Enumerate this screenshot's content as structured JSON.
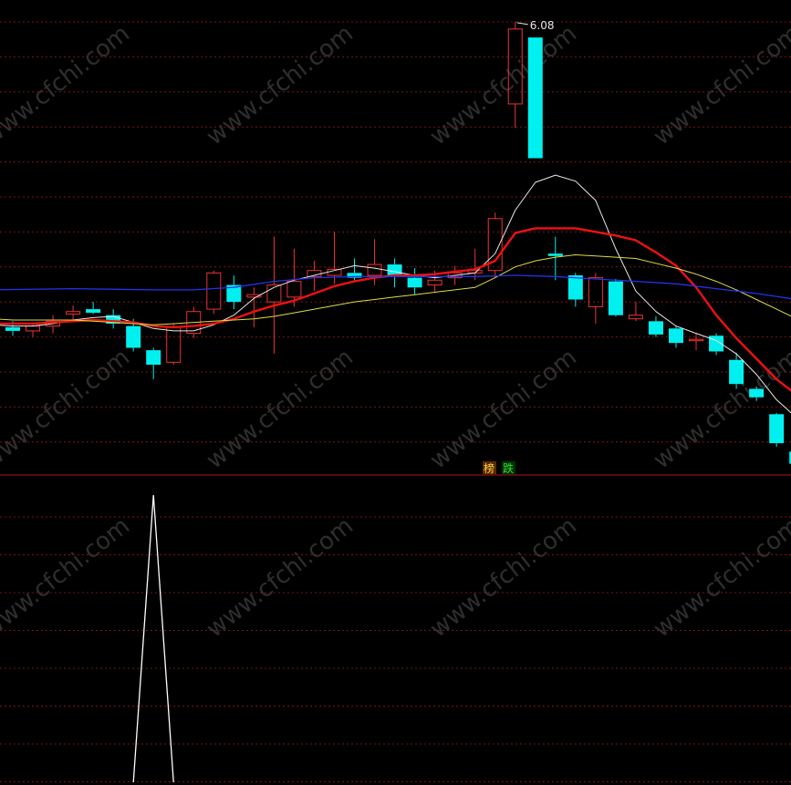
{
  "chart_data": {
    "type": "candlestick",
    "price_panel": {
      "ylim": [
        2.5,
        6.2
      ],
      "peak_label": "6.08",
      "peak_value": 6.08,
      "bottom_marker": "←",
      "signal_labels": [
        {
          "text": "榜",
          "color": "#ffd24a",
          "bg": "#5a2a00"
        },
        {
          "text": "跌",
          "color": "#33dd33",
          "bg": "#003300"
        }
      ],
      "candles": [
        {
          "i": 0,
          "o": 3.55,
          "h": 3.6,
          "l": 3.48,
          "c": 3.52
        },
        {
          "i": 1,
          "o": 3.52,
          "h": 3.58,
          "l": 3.47,
          "c": 3.56
        },
        {
          "i": 2,
          "o": 3.56,
          "h": 3.65,
          "l": 3.5,
          "c": 3.6
        },
        {
          "i": 3,
          "o": 3.66,
          "h": 3.73,
          "l": 3.61,
          "c": 3.68
        },
        {
          "i": 4,
          "o": 3.7,
          "h": 3.76,
          "l": 3.66,
          "c": 3.67
        },
        {
          "i": 5,
          "o": 3.65,
          "h": 3.7,
          "l": 3.54,
          "c": 3.58
        },
        {
          "i": 6,
          "o": 3.56,
          "h": 3.62,
          "l": 3.35,
          "c": 3.38
        },
        {
          "i": 7,
          "o": 3.36,
          "h": 3.38,
          "l": 3.12,
          "c": 3.24
        },
        {
          "i": 8,
          "o": 3.26,
          "h": 3.58,
          "l": 3.24,
          "c": 3.55
        },
        {
          "i": 9,
          "o": 3.5,
          "h": 3.72,
          "l": 3.46,
          "c": 3.68
        },
        {
          "i": 10,
          "o": 3.7,
          "h": 4.02,
          "l": 3.66,
          "c": 4.0
        },
        {
          "i": 11,
          "o": 3.9,
          "h": 3.98,
          "l": 3.7,
          "c": 3.76
        },
        {
          "i": 12,
          "o": 3.8,
          "h": 3.88,
          "l": 3.55,
          "c": 3.82
        },
        {
          "i": 13,
          "o": 3.76,
          "h": 4.3,
          "l": 3.33,
          "c": 3.9
        },
        {
          "i": 14,
          "o": 3.8,
          "h": 4.2,
          "l": 3.72,
          "c": 3.93
        },
        {
          "i": 15,
          "o": 3.97,
          "h": 4.1,
          "l": 3.85,
          "c": 4.02
        },
        {
          "i": 16,
          "o": 3.98,
          "h": 4.34,
          "l": 3.91,
          "c": 4.03
        },
        {
          "i": 17,
          "o": 4.0,
          "h": 4.12,
          "l": 3.94,
          "c": 3.96
        },
        {
          "i": 18,
          "o": 3.98,
          "h": 4.28,
          "l": 3.9,
          "c": 4.07
        },
        {
          "i": 19,
          "o": 4.07,
          "h": 4.12,
          "l": 3.88,
          "c": 3.98
        },
        {
          "i": 20,
          "o": 3.96,
          "h": 4.04,
          "l": 3.82,
          "c": 3.88
        },
        {
          "i": 21,
          "o": 3.9,
          "h": 4.02,
          "l": 3.84,
          "c": 3.94
        },
        {
          "i": 22,
          "o": 3.96,
          "h": 4.06,
          "l": 3.9,
          "c": 4.0
        },
        {
          "i": 23,
          "o": 4.0,
          "h": 4.2,
          "l": 3.94,
          "c": 4.02
        },
        {
          "i": 24,
          "o": 4.02,
          "h": 4.5,
          "l": 3.96,
          "c": 4.45
        },
        {
          "i": 25,
          "o": 5.4,
          "h": 6.08,
          "l": 5.2,
          "c": 6.02
        },
        {
          "i": 26,
          "o": 5.95,
          "h": 5.95,
          "l": 4.95,
          "c": 4.95
        },
        {
          "i": 27,
          "o": 4.16,
          "h": 4.3,
          "l": 3.94,
          "c": 4.14
        },
        {
          "i": 28,
          "o": 3.98,
          "h": 4.0,
          "l": 3.72,
          "c": 3.78
        },
        {
          "i": 29,
          "o": 3.72,
          "h": 4.0,
          "l": 3.58,
          "c": 3.96
        },
        {
          "i": 30,
          "o": 3.93,
          "h": 3.95,
          "l": 3.64,
          "c": 3.65
        },
        {
          "i": 31,
          "o": 3.62,
          "h": 3.76,
          "l": 3.6,
          "c": 3.65
        },
        {
          "i": 32,
          "o": 3.6,
          "h": 3.64,
          "l": 3.47,
          "c": 3.49
        },
        {
          "i": 33,
          "o": 3.54,
          "h": 3.56,
          "l": 3.38,
          "c": 3.42
        },
        {
          "i": 34,
          "o": 3.45,
          "h": 3.5,
          "l": 3.36,
          "c": 3.45
        },
        {
          "i": 35,
          "o": 3.48,
          "h": 3.5,
          "l": 3.32,
          "c": 3.35
        },
        {
          "i": 36,
          "o": 3.28,
          "h": 3.34,
          "l": 3.04,
          "c": 3.08
        },
        {
          "i": 37,
          "o": 3.04,
          "h": 3.06,
          "l": 2.94,
          "c": 2.97
        },
        {
          "i": 38,
          "o": 2.83,
          "h": 2.84,
          "l": 2.56,
          "c": 2.59
        },
        {
          "i": 39,
          "o": 2.52,
          "h": 2.54,
          "l": 2.38,
          "c": 2.42
        },
        {
          "i": 40,
          "o": 2.25,
          "h": 2.47,
          "l": 2.22,
          "c": 2.47
        }
      ],
      "ma_lines": [
        {
          "name": "MA5",
          "color": "#e8e8e8",
          "width": 1,
          "points": [
            [
              -1,
              3.57
            ],
            [
              0,
              3.56
            ],
            [
              1,
              3.56
            ],
            [
              2,
              3.58
            ],
            [
              3,
              3.61
            ],
            [
              4,
              3.63
            ],
            [
              5,
              3.64
            ],
            [
              6,
              3.59
            ],
            [
              7,
              3.54
            ],
            [
              8,
              3.52
            ],
            [
              9,
              3.52
            ],
            [
              10,
              3.57
            ],
            [
              11,
              3.65
            ],
            [
              12,
              3.79
            ],
            [
              13,
              3.88
            ],
            [
              14,
              3.94
            ],
            [
              15,
              3.98
            ],
            [
              16,
              4.02
            ],
            [
              17,
              4.06
            ],
            [
              18,
              4.04
            ],
            [
              19,
              4.01
            ],
            [
              20,
              3.98
            ],
            [
              21,
              3.96
            ],
            [
              22,
              3.98
            ],
            [
              23,
              4.0
            ],
            [
              24,
              4.16
            ],
            [
              25,
              4.52
            ],
            [
              26,
              4.75
            ],
            [
              27,
              4.81
            ],
            [
              28,
              4.76
            ],
            [
              29,
              4.6
            ],
            [
              30,
              4.2
            ],
            [
              31,
              3.85
            ],
            [
              32,
              3.68
            ],
            [
              33,
              3.56
            ],
            [
              34,
              3.5
            ],
            [
              35,
              3.44
            ],
            [
              36,
              3.33
            ],
            [
              37,
              3.16
            ],
            [
              38,
              2.95
            ],
            [
              39,
              2.8
            ],
            [
              40,
              2.62
            ]
          ]
        },
        {
          "name": "MA10",
          "color": "#ee1111",
          "width": 2.4,
          "points": [
            [
              -1,
              3.58
            ],
            [
              0,
              3.58
            ],
            [
              1,
              3.58
            ],
            [
              2,
              3.59
            ],
            [
              3,
              3.6
            ],
            [
              4,
              3.61
            ],
            [
              5,
              3.6
            ],
            [
              6,
              3.59
            ],
            [
              7,
              3.56
            ],
            [
              8,
              3.55
            ],
            [
              9,
              3.56
            ],
            [
              10,
              3.58
            ],
            [
              11,
              3.62
            ],
            [
              12,
              3.68
            ],
            [
              13,
              3.73
            ],
            [
              14,
              3.77
            ],
            [
              15,
              3.83
            ],
            [
              16,
              3.89
            ],
            [
              17,
              3.93
            ],
            [
              18,
              3.96
            ],
            [
              19,
              3.98
            ],
            [
              20,
              3.98
            ],
            [
              21,
              3.99
            ],
            [
              22,
              4.01
            ],
            [
              23,
              4.03
            ],
            [
              24,
              4.1
            ],
            [
              25,
              4.33
            ],
            [
              26,
              4.37
            ],
            [
              27,
              4.37
            ],
            [
              28,
              4.37
            ],
            [
              29,
              4.34
            ],
            [
              30,
              4.31
            ],
            [
              31,
              4.27
            ],
            [
              32,
              4.17
            ],
            [
              33,
              4.06
            ],
            [
              34,
              3.88
            ],
            [
              35,
              3.65
            ],
            [
              36,
              3.46
            ],
            [
              37,
              3.29
            ],
            [
              38,
              3.12
            ],
            [
              39,
              2.99
            ],
            [
              40,
              2.86
            ]
          ]
        },
        {
          "name": "MA20",
          "color": "#dddd44",
          "width": 1,
          "points": [
            [
              -1,
              3.62
            ],
            [
              0,
              3.61
            ],
            [
              1,
              3.61
            ],
            [
              2,
              3.61
            ],
            [
              3,
              3.61
            ],
            [
              4,
              3.6
            ],
            [
              5,
              3.59
            ],
            [
              6,
              3.58
            ],
            [
              7,
              3.57
            ],
            [
              8,
              3.58
            ],
            [
              9,
              3.59
            ],
            [
              10,
              3.6
            ],
            [
              11,
              3.61
            ],
            [
              12,
              3.62
            ],
            [
              13,
              3.64
            ],
            [
              14,
              3.67
            ],
            [
              15,
              3.7
            ],
            [
              16,
              3.73
            ],
            [
              17,
              3.76
            ],
            [
              18,
              3.78
            ],
            [
              19,
              3.8
            ],
            [
              20,
              3.82
            ],
            [
              21,
              3.84
            ],
            [
              22,
              3.86
            ],
            [
              23,
              3.88
            ],
            [
              24,
              3.96
            ],
            [
              25,
              4.05
            ],
            [
              26,
              4.1
            ],
            [
              27,
              4.13
            ],
            [
              28,
              4.15
            ],
            [
              29,
              4.14
            ],
            [
              30,
              4.13
            ],
            [
              31,
              4.12
            ],
            [
              32,
              4.08
            ],
            [
              33,
              4.04
            ],
            [
              34,
              3.99
            ],
            [
              35,
              3.93
            ],
            [
              36,
              3.86
            ],
            [
              37,
              3.78
            ],
            [
              38,
              3.7
            ],
            [
              39,
              3.62
            ],
            [
              40,
              3.56
            ]
          ]
        },
        {
          "name": "MA60",
          "color": "#2233ee",
          "width": 1.3,
          "points": [
            [
              -1,
              3.86
            ],
            [
              3,
              3.87
            ],
            [
              7,
              3.86
            ],
            [
              9,
              3.86
            ],
            [
              11,
              3.88
            ],
            [
              13,
              3.93
            ],
            [
              15,
              3.96
            ],
            [
              17,
              3.97
            ],
            [
              20,
              3.97
            ],
            [
              23,
              3.97
            ],
            [
              25,
              3.98
            ],
            [
              27,
              3.97
            ],
            [
              29,
              3.95
            ],
            [
              31,
              3.93
            ],
            [
              33,
              3.91
            ],
            [
              35,
              3.87
            ],
            [
              37,
              3.83
            ],
            [
              39,
              3.78
            ],
            [
              40,
              3.75
            ]
          ]
        }
      ]
    },
    "indicator_panel": {
      "ylim": [
        0,
        1
      ],
      "spike_index": 7,
      "values": [
        0,
        0,
        0,
        0,
        0,
        0,
        0,
        1,
        0,
        0,
        0,
        0,
        0,
        0,
        0,
        0,
        0,
        0,
        0,
        0,
        0,
        0,
        0,
        0,
        0,
        0,
        0,
        0,
        0,
        0,
        0,
        0,
        0,
        0,
        0,
        0,
        0,
        0,
        0,
        0,
        0
      ]
    },
    "colors": {
      "up": "#ee3333",
      "down": "#00f0f0",
      "grid": "#7a1515",
      "divider": "#b01818",
      "background": "#000000"
    },
    "watermark": "www.cfchi.com"
  }
}
